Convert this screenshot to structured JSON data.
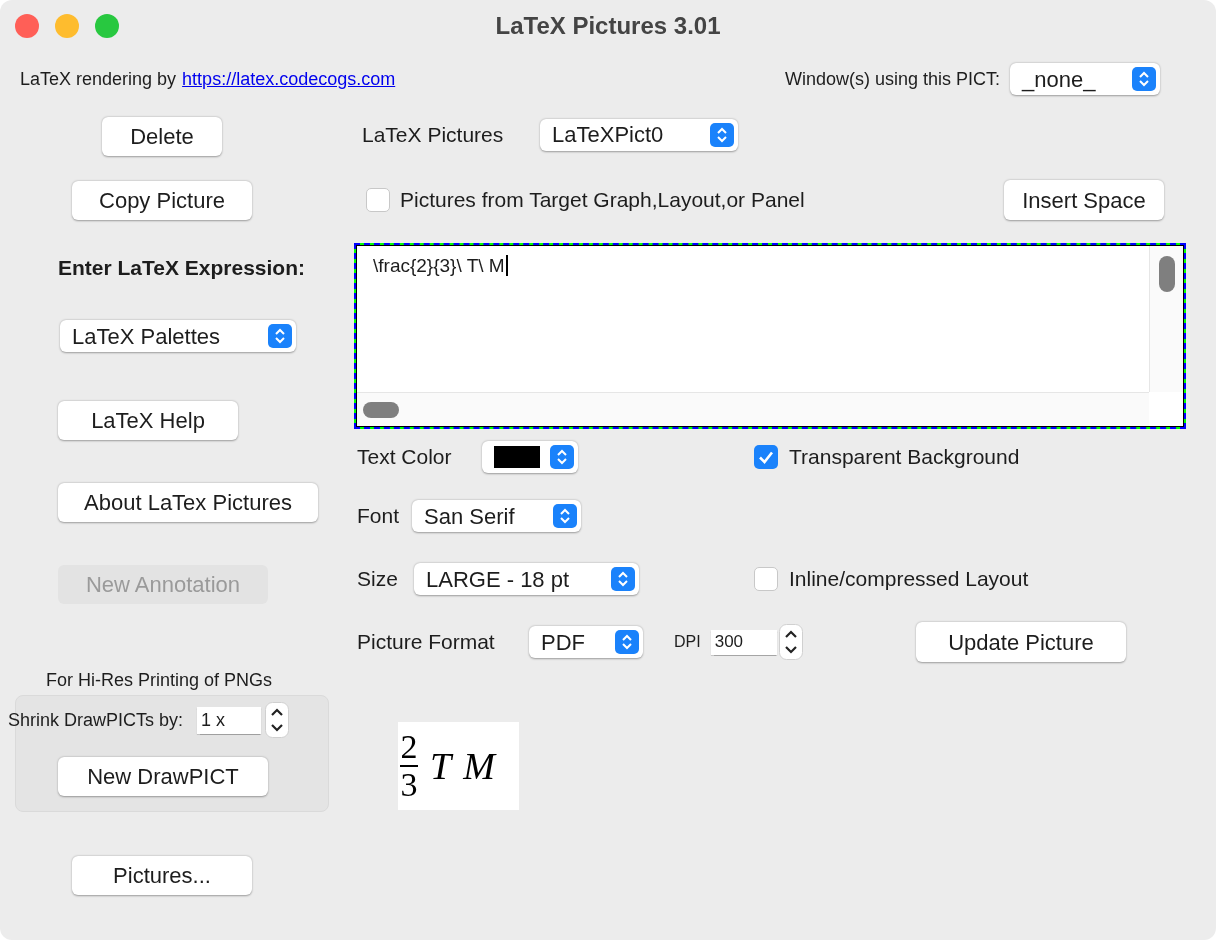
{
  "window": {
    "title": "LaTeX Pictures 3.01"
  },
  "credit": {
    "label": "LaTeX rendering by",
    "link": "https://latex.codecogs.com"
  },
  "pict_windows": {
    "label": "Window(s) using this PICT:",
    "value": "_none_"
  },
  "left_controls": [
    {
      "kind": "button",
      "label": "Delete",
      "disabled": false
    },
    {
      "kind": "button",
      "label": "Copy Picture",
      "disabled": false
    },
    {
      "kind": "label",
      "label": "Enter LaTeX Expression:"
    },
    {
      "kind": "popup",
      "label": "LaTeX Palettes"
    },
    {
      "kind": "button",
      "label": "LaTeX Help",
      "disabled": false
    },
    {
      "kind": "button",
      "label": "About LaTex Pictures",
      "disabled": false
    },
    {
      "kind": "button",
      "label": "New Annotation",
      "disabled": true
    }
  ],
  "hi_res": {
    "title": "For Hi-Res Printing of PNGs",
    "shrink_label": "Shrink DrawPICTs by:",
    "shrink_value": "1 x",
    "button": "New DrawPICT"
  },
  "pictures_button": "Pictures...",
  "latex_pictures": {
    "label": "LaTeX Pictures",
    "value": "LaTeXPict0"
  },
  "target_checkbox": {
    "label": "Pictures from Target Graph,Layout,or Panel",
    "checked": false
  },
  "insert_space": "Insert Space",
  "expression": "\\frac{2}{3}\\ T\\ M",
  "text_color": {
    "label": "Text Color",
    "color": "#000000"
  },
  "transparent_background": {
    "label": "Transparent Background",
    "checked": true
  },
  "font": {
    "label": "Font",
    "value": "San Serif"
  },
  "size": {
    "label": "Size",
    "value": "LARGE - 18 pt"
  },
  "inline_layout": {
    "label": "Inline/compressed Layout",
    "checked": false
  },
  "picture_format": {
    "label": "Picture Format",
    "value": "PDF"
  },
  "dpi": {
    "label": "DPI",
    "value": "300"
  },
  "update_button": "Update Picture",
  "preview": {
    "numerator": "2",
    "denominator": "3",
    "terms": [
      "T",
      "M"
    ]
  }
}
